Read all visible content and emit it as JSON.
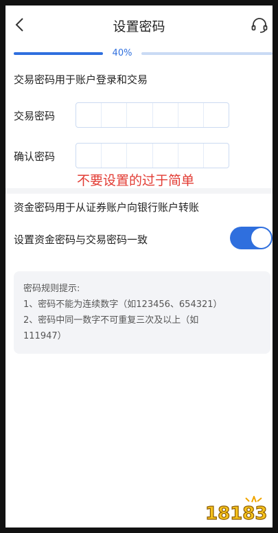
{
  "header": {
    "title": "设置密码"
  },
  "progress": {
    "percent_label": "40%",
    "value": 0.4
  },
  "intro": "交易密码用于账户登录和交易",
  "trade_password": {
    "label": "交易密码",
    "length": 6
  },
  "confirm_password": {
    "label": "确认密码",
    "length": 6
  },
  "warning": "不要设置的过于简单",
  "fund_description": "资金密码用于从证券账户向银行账户转账",
  "toggle": {
    "label": "设置资金密码与交易密码一致",
    "on": true
  },
  "rules": {
    "title": "密码规则提示:",
    "items": [
      "1、密码不能为连续数字（如123456、654321）",
      "2、密码中同一数字不可重复三次及以上（如",
      "111947）"
    ]
  },
  "watermark": "18183",
  "colors": {
    "accent": "#2f6fde",
    "warning": "#e23b33"
  }
}
